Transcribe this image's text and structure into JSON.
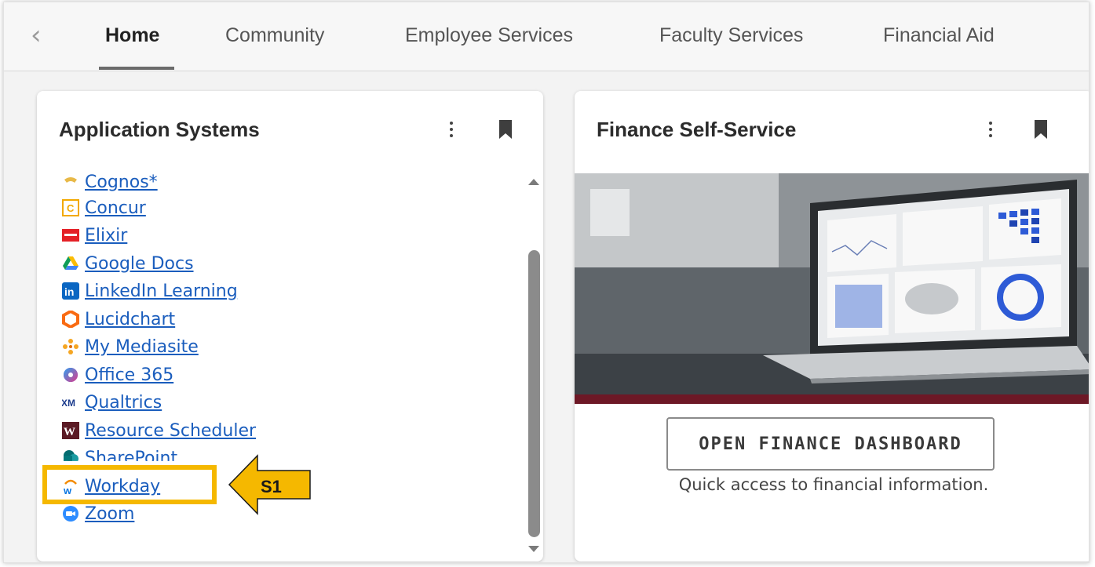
{
  "nav": {
    "tabs": [
      {
        "label": "Home",
        "active": true
      },
      {
        "label": "Community"
      },
      {
        "label": "Employee Services"
      },
      {
        "label": "Faculty Services"
      },
      {
        "label": "Financial Aid"
      }
    ]
  },
  "application_systems": {
    "title": "Application Systems",
    "items": [
      {
        "label": "Cognos*",
        "icon": "cognos-icon"
      },
      {
        "label": "Concur",
        "icon": "concur-icon"
      },
      {
        "label": "Elixir",
        "icon": "elixir-icon"
      },
      {
        "label": "Google Docs",
        "icon": "google-drive-icon"
      },
      {
        "label": "LinkedIn Learning",
        "icon": "linkedin-icon"
      },
      {
        "label": "Lucidchart",
        "icon": "lucidchart-icon"
      },
      {
        "label": "My Mediasite",
        "icon": "mediasite-icon"
      },
      {
        "label": "Office 365",
        "icon": "office365-icon"
      },
      {
        "label": "Qualtrics",
        "icon": "qualtrics-icon"
      },
      {
        "label": "Resource Scheduler",
        "icon": "resource-scheduler-icon"
      },
      {
        "label": "SharePoint",
        "icon": "sharepoint-icon"
      },
      {
        "label": "Workday",
        "icon": "workday-icon"
      },
      {
        "label": "Zoom",
        "icon": "zoom-icon"
      }
    ]
  },
  "finance": {
    "title": "Finance Self-Service",
    "button_label": "OPEN FINANCE DASHBOARD",
    "caption": "Quick access to financial information."
  },
  "annotation": {
    "label": "S1",
    "color": "#f5b800"
  },
  "colors": {
    "link": "#1a5dbd",
    "accent_bar": "#6d1826"
  }
}
